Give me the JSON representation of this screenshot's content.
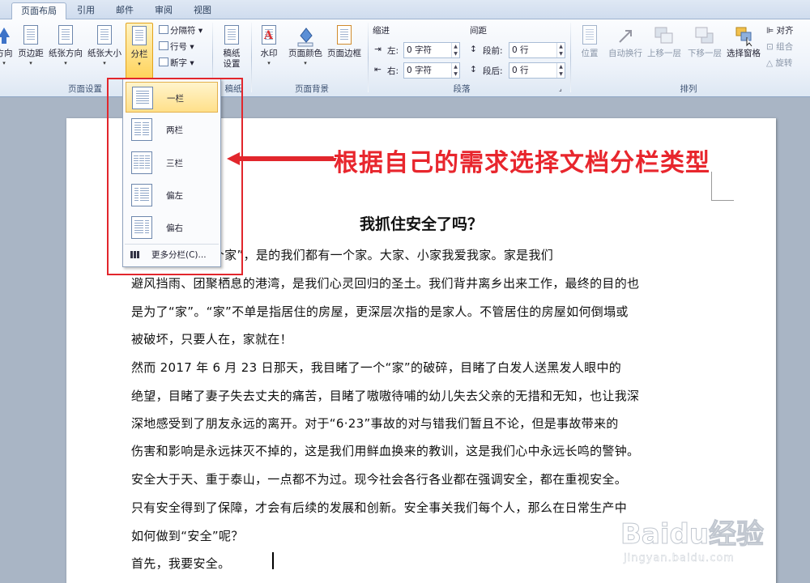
{
  "tabs": [
    {
      "label": "页面布局",
      "active": true
    },
    {
      "label": "引用",
      "active": false
    },
    {
      "label": "邮件",
      "active": false
    },
    {
      "label": "审阅",
      "active": false
    },
    {
      "label": "视图",
      "active": false
    }
  ],
  "ribbon": {
    "page_setup": {
      "group_label": "页面设置",
      "orientation_label": "方向",
      "margins_label": "页边距",
      "orientation_full_label": "纸张方向",
      "size_label": "纸张大小",
      "columns_label": "分栏",
      "breaks_label": "分隔符",
      "line_numbers_label": "行号",
      "hyphenation_label": "断字"
    },
    "manuscript": {
      "group_label": "稿纸",
      "button_label_1": "稿纸",
      "button_label_2": "设置"
    },
    "page_background": {
      "group_label": "页面背景",
      "watermark_label": "水印",
      "page_color_label": "页面颜色",
      "page_border_label": "页面边框"
    },
    "paragraph": {
      "group_label": "段落",
      "indent_header": "缩进",
      "spacing_header": "间距",
      "indent_left_label": "左:",
      "indent_left_value": "0 字符",
      "indent_right_label": "右:",
      "indent_right_value": "0 字符",
      "space_before_label": "段前:",
      "space_before_value": "0 行",
      "space_after_label": "段后:",
      "space_after_value": "0 行"
    },
    "arrange": {
      "group_label": "排列",
      "position_label": "位置",
      "wrap_label": "自动换行",
      "bring_forward_label": "上移一层",
      "send_backward_label": "下移一层",
      "selection_pane_label": "选择窗格",
      "align_label": "对齐",
      "group_btn_label": "组合",
      "rotate_label": "旋转"
    }
  },
  "columns_menu": {
    "items": [
      {
        "label": "一栏",
        "selected": true
      },
      {
        "label": "两栏",
        "selected": false
      },
      {
        "label": "三栏",
        "selected": false
      },
      {
        "label": "偏左",
        "selected": false
      },
      {
        "label": "偏右",
        "selected": false
      }
    ],
    "more_label": "更多分栏(C)..."
  },
  "annotation": {
    "text": "根据自己的需求选择文档分栏类型",
    "color": "#e8262d"
  },
  "document": {
    "title": "我抓住安全了吗？",
    "lines": [
      "到“我们都有一个家”，是的我们都有一个家。大家、小家我爱我家。家是我们",
      "避风挡雨、团聚栖息的港湾，是我们心灵回归的圣土。我们背井离乡出来工作，最终的目的也",
      "是为了“家”。“家”不单是指居住的房屋，更深层次指的是家人。不管居住的房屋如何倒塌或",
      "被破坏，只要人在，家就在！",
      "    然而 2017 年 6 月 23 日那天，我目睹了一个“家”的破碎，目睹了白发人送黑发人眼中的",
      "绝望，目睹了妻子失去丈夫的痛苦，目睹了嗷嗷待哺的幼儿失去父亲的无措和无知，也让我深",
      "深地感受到了朋友永远的离开。对于“6·23”事故的对与错我们暂且不论，但是事故带来的",
      "伤害和影响是永远抹灭不掉的，这是我们用鲜血换来的教训，这是我们心中永远长鸣的警钟。",
      "    安全大于天、重于泰山，一点都不为过。现今社会各行各业都在强调安全，都在重视安全。",
      "只有安全得到了保障，才会有后续的发展和创新。安全事关我们每个人，那么在日常生产中",
      "如何做到“安全”呢？",
      "    首先，我要安全。"
    ]
  },
  "watermark": {
    "brand": "Baidu经验",
    "url": "jingyan.baidu.com"
  }
}
